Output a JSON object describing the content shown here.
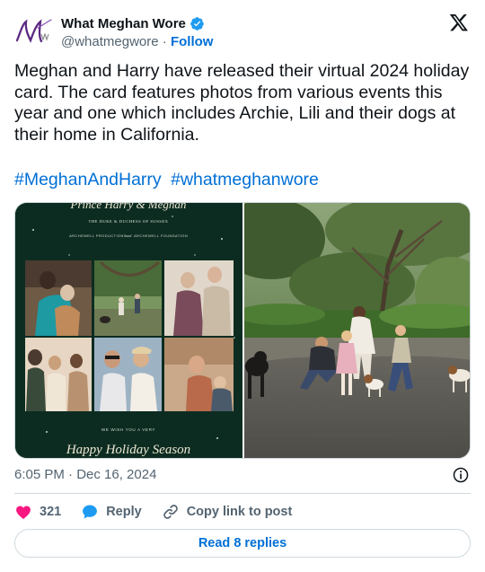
{
  "account": {
    "display_name": "What Meghan Wore",
    "handle": "@whatmegwore",
    "separator": "·",
    "follow_label": "Follow",
    "avatar_icon": "wmw-monogram-logo",
    "verified_icon": "verified-badge-icon"
  },
  "tweet": {
    "text": "Meghan and Harry have released their virtual 2024 holiday card. The card features photos from various events this year and one which includes Archie, Lili and their dogs at their home in California.",
    "hashtags": [
      "#MeghanAndHarry",
      "#whatmeghanwore"
    ]
  },
  "media": {
    "card": {
      "script_title": "Prince Harry & Meghan",
      "subtitle": "THE DUKE & DUCHESS OF SUSSEX",
      "org_left": "ARCHEWELL PRODUCTIONS",
      "org_joiner": "and",
      "org_right": "ARCHEWELL FOUNDATION",
      "wish": "WE WISH YOU A VERY",
      "greeting": "Happy Holiday Season"
    }
  },
  "meta": {
    "timestamp": "6:05 PM · Dec 16, 2024"
  },
  "actions": {
    "like_count": "321",
    "reply_label": "Reply",
    "copy_label": "Copy link to post",
    "read_replies_label": "Read 8 replies"
  },
  "colors": {
    "link": "#006fd6",
    "like": "#f91880",
    "reply": "#1d9bf0",
    "card_green": "#0d2c21"
  }
}
